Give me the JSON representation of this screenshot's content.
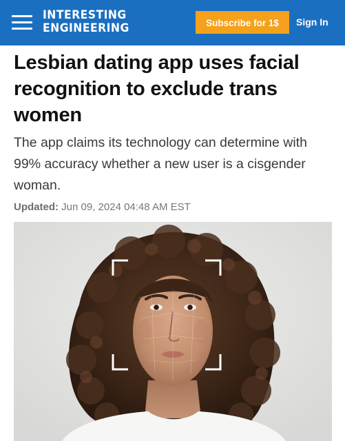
{
  "header": {
    "logo_line1": "INTERESTING",
    "logo_line2": "ENGINEERING",
    "subscribe_label": "Subscribe for 1$",
    "signin_label": "Sign In",
    "brand_color": "#1b6fc1",
    "subscribe_color": "#f5a11b"
  },
  "article": {
    "headline": "Lesbian dating app uses facial recognition to exclude trans women",
    "subheadline": "The app claims its technology can determine with 99% accuracy whether a new user is a cisgender woman.",
    "updated_label": "Updated:",
    "updated_value": "Jun 09, 2024 04:48 AM EST"
  },
  "hero_image": {
    "subject": "photo-woman-face-scan",
    "overlay_icon": "face-scan-frame-icon"
  }
}
